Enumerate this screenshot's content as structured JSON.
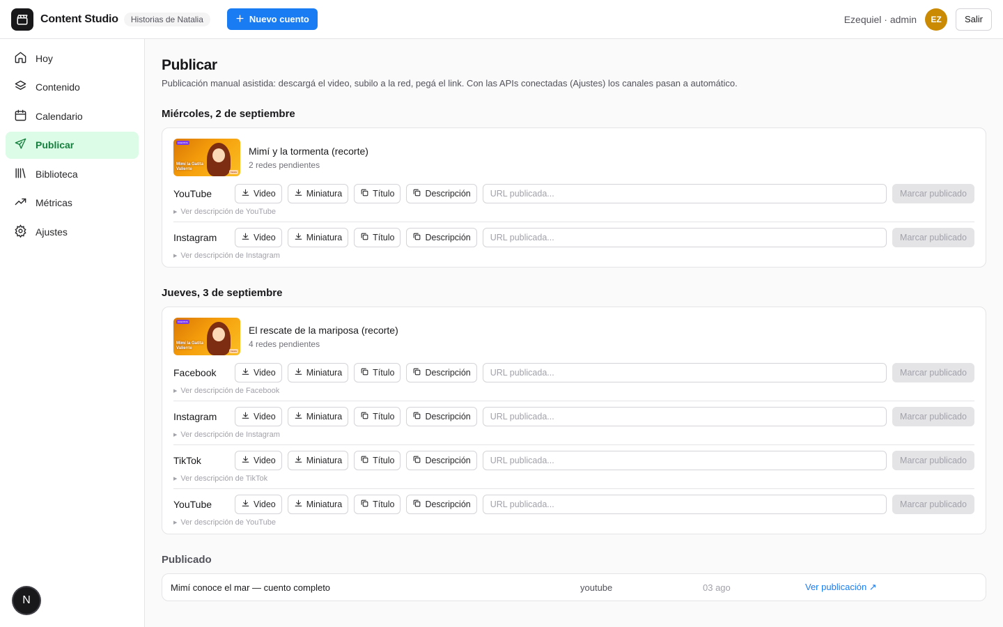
{
  "header": {
    "app_name": "Content Studio",
    "workspace": "Historias de Natalia",
    "new_button": "Nuevo cuento",
    "user_label": "Ezequiel · admin",
    "avatar_initials": "EZ",
    "logout": "Salir"
  },
  "sidebar": {
    "items": [
      {
        "label": "Hoy",
        "icon": "home-icon"
      },
      {
        "label": "Contenido",
        "icon": "layers-icon"
      },
      {
        "label": "Calendario",
        "icon": "calendar-icon"
      },
      {
        "label": "Publicar",
        "icon": "send-icon",
        "active": true
      },
      {
        "label": "Biblioteca",
        "icon": "library-icon"
      },
      {
        "label": "Métricas",
        "icon": "trend-icon"
      },
      {
        "label": "Ajustes",
        "icon": "gear-icon"
      }
    ],
    "badge": "N"
  },
  "main": {
    "title": "Publicar",
    "subtitle": "Publicación manual asistida: descargá el video, subilo a la red, pegá el link. Con las APIs conectadas (Ajustes) los canales pasan a automático.",
    "row_labels": {
      "video": "Video",
      "thumbnail": "Miniatura",
      "title": "Título",
      "description": "Descripción",
      "url_placeholder": "URL publicada...",
      "mark": "Marcar publicado"
    },
    "thumb": {
      "tag": "CUENTOS",
      "title_line1": "Mimí la Gatita",
      "title_line2": "Valiente",
      "pill": "Natalia"
    },
    "days": [
      {
        "heading": "Miércoles, 2 de septiembre",
        "item": {
          "title": "Mimí y la tormenta (recorte)",
          "pending": "2 redes pendientes",
          "rows": [
            {
              "network": "YouTube",
              "toggle": "Ver descripción de YouTube"
            },
            {
              "network": "Instagram",
              "toggle": "Ver descripción de Instagram"
            }
          ]
        }
      },
      {
        "heading": "Jueves, 3 de septiembre",
        "item": {
          "title": "El rescate de la mariposa (recorte)",
          "pending": "4 redes pendientes",
          "rows": [
            {
              "network": "Facebook",
              "toggle": "Ver descripción de Facebook"
            },
            {
              "network": "Instagram",
              "toggle": "Ver descripción de Instagram"
            },
            {
              "network": "TikTok",
              "toggle": "Ver descripción de TikTok"
            },
            {
              "network": "YouTube",
              "toggle": "Ver descripción de YouTube"
            }
          ]
        }
      }
    ],
    "published": {
      "heading": "Publicado",
      "rows": [
        {
          "title": "Mimí conoce el mar — cuento completo",
          "platform": "youtube",
          "date": "03 ago",
          "link": "Ver publicación ↗"
        }
      ]
    }
  }
}
